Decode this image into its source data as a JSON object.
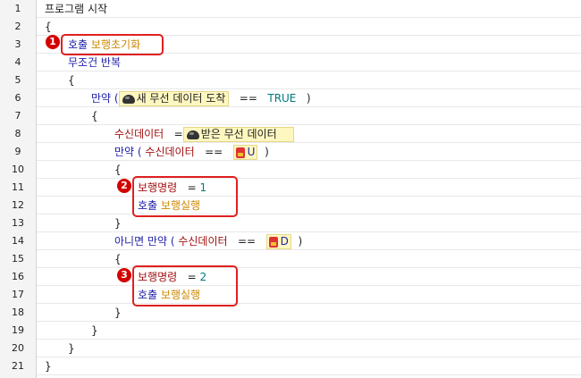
{
  "lines": [
    {
      "no": "1"
    },
    {
      "no": "2"
    },
    {
      "no": "3"
    },
    {
      "no": "4"
    },
    {
      "no": "5"
    },
    {
      "no": "6"
    },
    {
      "no": "7"
    },
    {
      "no": "8"
    },
    {
      "no": "9"
    },
    {
      "no": "10"
    },
    {
      "no": "11"
    },
    {
      "no": "12"
    },
    {
      "no": "13"
    },
    {
      "no": "14"
    },
    {
      "no": "15"
    },
    {
      "no": "16"
    },
    {
      "no": "17"
    },
    {
      "no": "18"
    },
    {
      "no": "19"
    },
    {
      "no": "20"
    },
    {
      "no": "21"
    }
  ],
  "code": {
    "l1": "프로그램 시작",
    "open": "{",
    "close": "}",
    "call": "호출",
    "walk_init": "보행초기화",
    "loop": "무조건 반복",
    "if": "만약 (",
    "if2": "만약 (",
    "else_if": "아니면 만약 (",
    "new_data_arrived": "새 무선 데이터 도착",
    "eq": "==",
    "true": "TRUE",
    "paren_close": ")",
    "recv_data": "수신데이터",
    "assign": "=",
    "received_wireless": "받은 무선 데이터",
    "key_u": "U",
    "key_d": "D",
    "walk_cmd": "보행명령",
    "val1": "1",
    "val2": "2",
    "walk_run": "보행실행"
  },
  "badges": {
    "b1": "1",
    "b2": "2",
    "b3": "3"
  }
}
